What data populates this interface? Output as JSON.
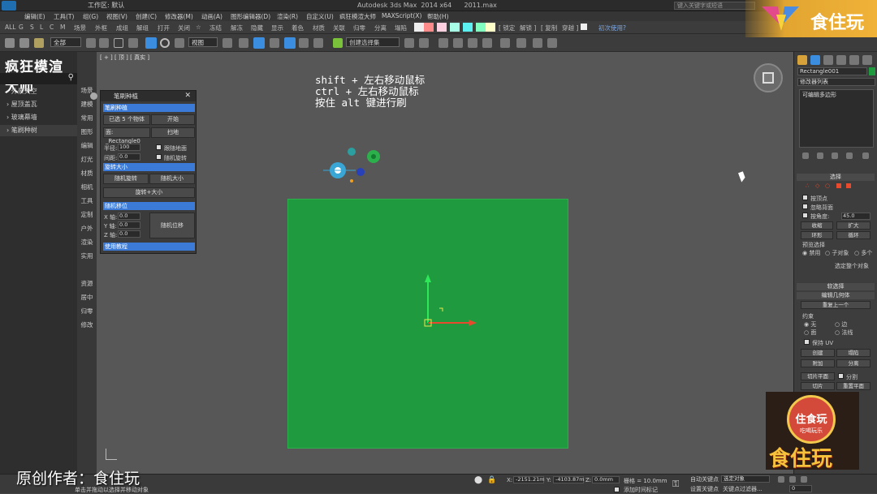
{
  "titlebar": {
    "workspace": "工作区: 默认",
    "title": "Autodesk 3ds Max  2014 x64      2011.max",
    "search_placeholder": "键入关键字或短语"
  },
  "menubar": [
    "编辑(E)",
    "工具(T)",
    "组(G)",
    "视图(V)",
    "创建(C)",
    "修改器(M)",
    "动画(A)",
    "图形编辑器(D)",
    "渲染(R)",
    "自定义(U)",
    "疯狂模渲大师",
    "MAXScript(X)",
    "帮助(H)"
  ],
  "toolbar1": {
    "filters": [
      "ALL",
      "G",
      "S",
      "L",
      "C",
      "M"
    ],
    "items": [
      "场景",
      "外框",
      "成组",
      "解组",
      "打开",
      "关闭",
      "☆",
      "冻结",
      "解冻",
      "隐藏",
      "显示",
      "着色",
      "材质",
      "关联",
      "归零",
      "分离",
      "塌陷"
    ],
    "right_items": [
      "[ 锁定",
      "解锁 ]",
      "[ 复制",
      "穿越 ]"
    ],
    "first_use": "初次使用?",
    "swatch_colors": [
      "#ff8a8a",
      "#ffd0e0",
      "#a8ffe8",
      "#5cf0f0",
      "#80ffc0",
      "#ffffc8"
    ]
  },
  "toolbar2": {
    "filter_value": "全部",
    "view_value": "视图",
    "selection_set": "创建选择集"
  },
  "leftpanel": {
    "brand": "疯狂模渲大师",
    "items": [
      "外景天空",
      "屋顶盖瓦",
      "玻璃幕墙",
      "笔刷种树"
    ],
    "categories": [
      "场景",
      "建模",
      "常用",
      "图形",
      "编辑",
      "灯光",
      "材质",
      "相机",
      "工具",
      "定制",
      "户外",
      "渲染",
      "实用",
      "资源",
      "居中",
      "归零",
      "修改"
    ]
  },
  "viewport": {
    "label": "[ + ] [ 顶 ] [ 真实 ]",
    "instructions": [
      "shift + 左右移动鼠标",
      "ctrl + 左右移动鼠标",
      "按住 alt 键进行刷"
    ],
    "plane_color": "#1f9a3e"
  },
  "toolwin": {
    "title": "笔刷种植",
    "sec_brush": "笔刷种植",
    "btn_selected": "已选 5 个物体",
    "btn_start": "开始",
    "btn_surface": "面: _Rectangle0",
    "btn_sweep": "扫地",
    "radius_label": "半径:",
    "radius_value": "100",
    "spacing_label": "间距:",
    "spacing_value": "0.0",
    "chk_follow_ground": "跟随地面",
    "chk_random_rotate": "随机旋转",
    "sec_rotate_scale": "旋转大小",
    "btn_rand_rotate": "随机旋转",
    "btn_rand_size": "随机大小",
    "btn_rotate_size": "旋转+大小",
    "sec_offset": "随机移位",
    "x_label": "X 轴:",
    "y_label": "Y 轴:",
    "z_label": "Z 轴:",
    "axis_value": "0.0",
    "btn_rand_offset": "随机位移",
    "sec_tutorial": "使用教程"
  },
  "rightpanel": {
    "object_name": "Rectangle001",
    "modifier_list": "修改器列表",
    "stack_item": "可编辑多边形",
    "select_header": "选择",
    "by_vertex": "按顶点",
    "ignore_back": "忽略背面",
    "by_angle": "按角度:",
    "angle_value": "45.0",
    "shrink": "收缩",
    "grow": "扩大",
    "ring": "环形",
    "loop": "循环",
    "preview_select": "预览选择",
    "disabled": "禁用",
    "sub_object": "子对象",
    "multi": "多个",
    "select_all": "选定整个对象",
    "soft_select": "软选择",
    "edit_geometry": "编辑几何体",
    "repeat_last": "重复上一个",
    "constraints": "约束",
    "none": "无",
    "edge": "边",
    "face": "面",
    "normal": "法线",
    "preserve_uv": "保持 UV",
    "create": "创建",
    "collapse": "塌陷",
    "attach": "附加",
    "detach": "分离",
    "slice_plane": "切片平面",
    "split": "分割",
    "slice": "切片",
    "reset_plane": "重置平面"
  },
  "bottombar": {
    "status": "单击并拖动以选择并移动对象",
    "x_label": "X:",
    "x_value": "-2151.21m",
    "y_label": "Y:",
    "y_value": "-4103.87m",
    "z_label": "Z:",
    "z_value": "0.0mm",
    "grid": "栅格 = 10.0mm",
    "add_time_tag": "添加时间标记",
    "auto_key": "自动关键点",
    "set_key": "设置关键点",
    "selected_object": "选定对象",
    "key_filters": "关键点过滤器...",
    "frame": "0"
  },
  "overlay": {
    "author": "原创作者：食住玩",
    "brand_top": "食住玩",
    "brand_badge": "住食玩",
    "brand_badge_sub": "吃喝玩乐",
    "brand_bottom": "食住玩"
  }
}
